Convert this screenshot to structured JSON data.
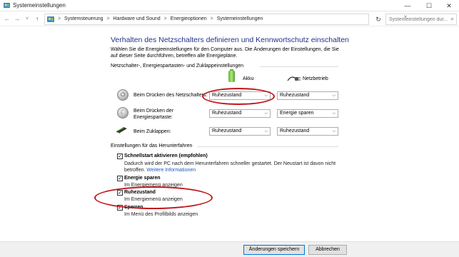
{
  "window": {
    "title": "Systemeinstellungen",
    "minimize_glyph": "—",
    "maximize_glyph": "☐",
    "close_glyph": "✕"
  },
  "nav": {
    "back_glyph": "←",
    "forward_glyph": "→",
    "recent_glyph": "˅",
    "up_glyph": "↑",
    "refresh_glyph": "↻",
    "dropdown_glyph": "˅"
  },
  "breadcrumbs": [
    "Systemsteuerung",
    "Hardware und Sound",
    "Energieoptionen",
    "Systemeinstellungen"
  ],
  "breadcrumb_separator": ">",
  "search": {
    "placeholder": "Systemeinstellungen dur...",
    "icon": "search-icon"
  },
  "page": {
    "heading": "Verhalten des Netzschalters definieren und Kennwortschutz einschalten",
    "intro": "Wählen Sie die Energieeinstellungen für den Computer aus. Die Änderungen der Einstellungen, die Sie auf dieser Seite durchführen, betreffen alle Energiepläne."
  },
  "buttons_section": {
    "title": "Netzschalter-, Energiespartasten- und Zuklappeinstellungen",
    "col_akku": "Akku",
    "col_netzbetrieb": "Netzbetrieb",
    "rows": [
      {
        "label": "Beim Drücken des Netzschalters:",
        "icon": "power-button-icon",
        "akku": "Ruhezustand",
        "netz": "Ruhezustand"
      },
      {
        "label": "Beim Drücken der Energiespartaste:",
        "icon": "sleep-button-icon",
        "akku": "Ruhezustand",
        "netz": "Energie sparen"
      },
      {
        "label": "Beim Zuklappen:",
        "icon": "laptop-lid-icon",
        "akku": "Ruhezustand",
        "netz": "Ruhezustand"
      }
    ]
  },
  "shutdown_section": {
    "title": "Einstellungen für das Herunterfahren",
    "options": [
      {
        "title": "Schnellstart aktivieren (empfohlen)",
        "checked": true,
        "desc": "Dadurch wird der PC nach dem Herunterfahren schneller gestartet. Der Neustart ist davon nicht betroffen.",
        "link": "Weitere Informationen"
      },
      {
        "title": "Energie sparen",
        "checked": true,
        "desc": "Im Energiemenü anzeigen"
      },
      {
        "title": "Ruhezustand",
        "checked": true,
        "desc": "Im Energiemenü anzeigen"
      },
      {
        "title": "Sperren",
        "checked": true,
        "desc": "Im Menü des Profilbilds anzeigen"
      }
    ]
  },
  "footer": {
    "save_label": "Änderungen speichern",
    "cancel_label": "Abbrechen"
  },
  "colors": {
    "heading": "#1e3287",
    "annotation": "#c0161d",
    "link": "#1a5dbb"
  }
}
